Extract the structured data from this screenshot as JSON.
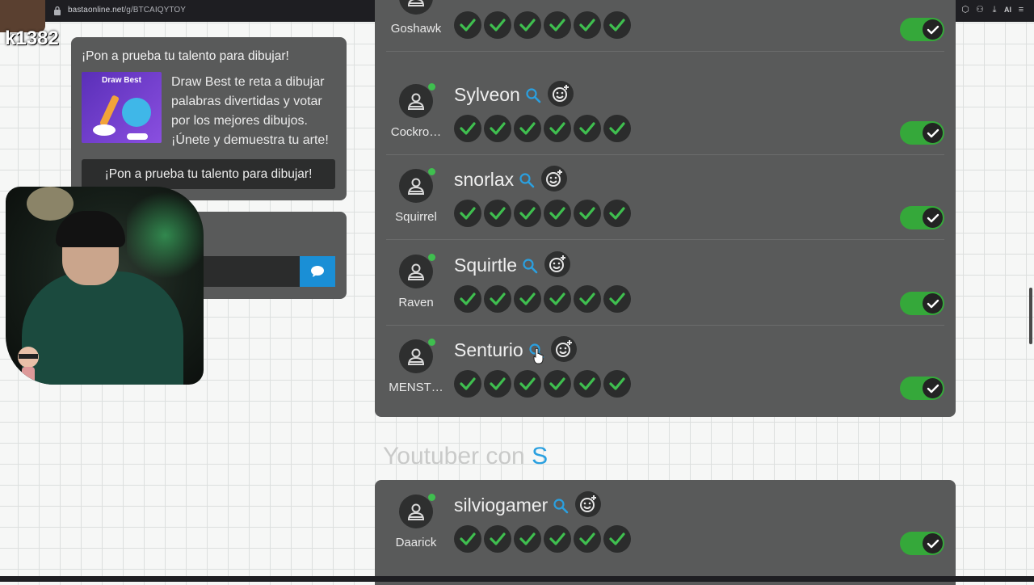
{
  "browser": {
    "url_host": "bastaonline.net",
    "url_path": "/g/BTCAIQYTOY",
    "ai_label": "AI"
  },
  "stream_overlay": {
    "tag": "k1382"
  },
  "ad": {
    "title": "¡Pon a prueba tu talento para dibujar!",
    "image_title": "Draw Best",
    "description": "Draw Best te reta a dibujar palabras divertidas y votar por los mejores dibujos. ¡Únete y demuestra tu arte!",
    "button_label": "¡Pon a prueba tu talento para dibujar!"
  },
  "chat": {
    "send_icon": "speech-bubble-icon"
  },
  "players": [
    {
      "username": "Goshawk",
      "answer": "",
      "checks": 6,
      "online": false
    },
    {
      "username": "Cockro…",
      "answer": "Sylveon",
      "checks": 6,
      "online": true
    },
    {
      "username": "Squirrel",
      "answer": "snorlax",
      "checks": 6,
      "online": true
    },
    {
      "username": "Raven",
      "answer": "Squirtle",
      "checks": 6,
      "online": true
    },
    {
      "username": "MENST…",
      "answer": "Senturio",
      "checks": 6,
      "online": true
    }
  ],
  "section": {
    "prefix": "Youtuber con",
    "letter": "S"
  },
  "players_2": [
    {
      "username": "Daarick",
      "answer": "silviogamer",
      "checks": 6,
      "online": true
    }
  ],
  "colors": {
    "check_green": "#3fbf4f",
    "toggle_green": "#35a83a",
    "accent_blue": "#2aa0e0",
    "panel_gray": "#595a5a"
  }
}
